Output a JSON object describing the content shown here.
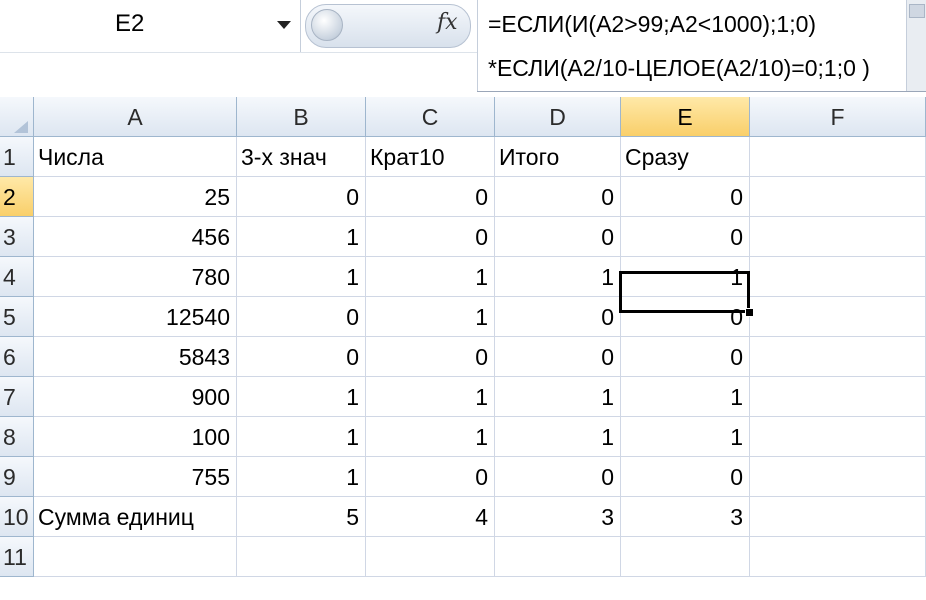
{
  "formula_bar": {
    "name_box": "E2",
    "fx_symbol": "fx",
    "formula_line1": "=ЕСЛИ(И(A2>99;A2<1000);1;0)",
    "formula_line2": "*ЕСЛИ(A2/10-ЦЕЛОЕ(A2/10)=0;1;0 )"
  },
  "grid": {
    "columns": [
      "A",
      "B",
      "C",
      "D",
      "E",
      "F"
    ],
    "active_cell": "E2",
    "rows": [
      {
        "n": "1",
        "a": "Числа",
        "b": "3-х знач",
        "c": "Крат10",
        "d": "Итого",
        "e": "Сразу",
        "f": ""
      },
      {
        "n": "2",
        "a": "25",
        "b": "0",
        "c": "0",
        "d": "0",
        "e": "0",
        "f": ""
      },
      {
        "n": "3",
        "a": "456",
        "b": "1",
        "c": "0",
        "d": "0",
        "e": "0",
        "f": ""
      },
      {
        "n": "4",
        "a": "780",
        "b": "1",
        "c": "1",
        "d": "1",
        "e": "1",
        "f": ""
      },
      {
        "n": "5",
        "a": "12540",
        "b": "0",
        "c": "1",
        "d": "0",
        "e": "0",
        "f": ""
      },
      {
        "n": "6",
        "a": "5843",
        "b": "0",
        "c": "0",
        "d": "0",
        "e": "0",
        "f": ""
      },
      {
        "n": "7",
        "a": "900",
        "b": "1",
        "c": "1",
        "d": "1",
        "e": "1",
        "f": ""
      },
      {
        "n": "8",
        "a": "100",
        "b": "1",
        "c": "1",
        "d": "1",
        "e": "1",
        "f": ""
      },
      {
        "n": "9",
        "a": "755",
        "b": "1",
        "c": "0",
        "d": "0",
        "e": "0",
        "f": ""
      },
      {
        "n": "10",
        "a": "Сумма единиц",
        "b": "5",
        "c": "4",
        "d": "3",
        "e": "3",
        "f": ""
      },
      {
        "n": "11",
        "a": "",
        "b": "",
        "c": "",
        "d": "",
        "e": "",
        "f": ""
      }
    ]
  },
  "colors": {
    "header_active": "#f9cf6a",
    "gridline": "#d0d7e5",
    "header_border": "#9eb6ce"
  }
}
